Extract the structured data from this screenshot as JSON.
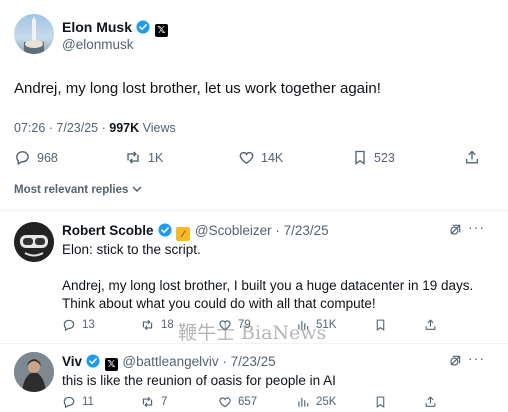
{
  "post": {
    "author_name": "Elon Musk",
    "author_handle": "@elonmusk",
    "text": "Andrej, my long lost brother, let us work together again!",
    "time": "07:26",
    "date": "7/23/25",
    "views_count": "997K",
    "views_label": "Views",
    "replies": "968",
    "reposts": "1K",
    "likes": "14K",
    "bookmarks": "523",
    "verified_color": "#1d9bf0"
  },
  "replies_filter": {
    "label": "Most relevant replies"
  },
  "replies": [
    {
      "author_name": "Robert Scoble",
      "handle_date": "@Scobleizer · 7/23/25",
      "text_line1": "Elon: stick to the script.",
      "text_line2": "Andrej, my long lost brother, I built you a huge datacenter in 19 days.",
      "text_line3": "Think about what you could do with all that compute!",
      "replies": "13",
      "reposts": "18",
      "likes": "79",
      "views": "51K"
    },
    {
      "author_name": "Viv",
      "handle_date": "@battleangelviv · 7/23/25",
      "text": "this is like the reunion of oasis for people in AI",
      "replies": "11",
      "reposts": "7",
      "likes": "657",
      "views": "25K"
    }
  ],
  "watermark": "鞭牛士 BiaNews"
}
